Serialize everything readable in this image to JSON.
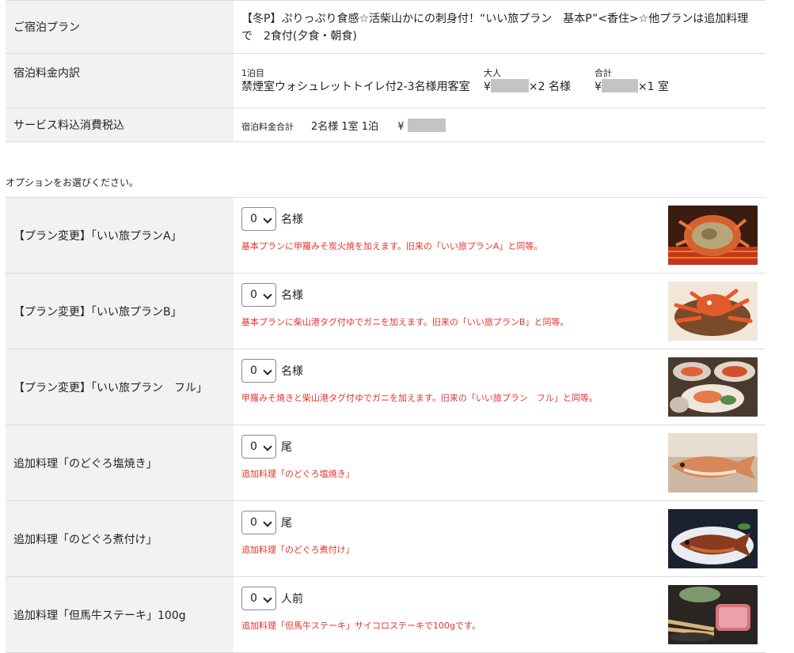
{
  "summary": {
    "plan_label": "ご宿泊プラン",
    "plan_name": "【冬P】ぷりっぷり食感☆活柴山かにの刺身付！“いい旅プラン　基本P”<香住>☆他プランは追加料理で　2食付(夕食・朝食)",
    "breakdown_label": "宿泊料金内訳",
    "night_head": "1泊目",
    "room_type": "禁煙室ウォシュレットトイレ付2-3名様用客室",
    "adult_head": "大人",
    "adult_value_prefix": "¥",
    "adult_value_suffix": "×2 名様",
    "total_head": "合計",
    "total_value_prefix": "¥",
    "total_value_suffix": "×1 室",
    "tax_label": "サービス料込消費税込",
    "grand_total_head": "宿泊料金合計",
    "grand_total_detail": "2名様  1室  1泊",
    "grand_total_prefix": "¥"
  },
  "options_title": "オプションをお選びください。",
  "options": [
    {
      "label": "【プラン変更】「いい旅プランA」",
      "selected": "0",
      "unit": "名様",
      "desc": "基本プランに甲羅みそ炭火焼を加えます。旧来の「いい旅プランA」と同等。",
      "image": "crab-grill-photo"
    },
    {
      "label": "【プラン変更】「いい旅プランB」",
      "selected": "0",
      "unit": "名様",
      "desc": "基本プランに柴山港タグ付ゆでガニを加えます。旧来の「いい旅プランB」と同等。",
      "image": "boiled-crab-photo"
    },
    {
      "label": "【プラン変更】「いい旅プラン　フル」",
      "selected": "0",
      "unit": "名様",
      "desc": "甲羅みそ焼きと柴山港タグ付ゆでガニを加えます。旧来の「いい旅プラン　フル」と同等。",
      "image": "crab-feast-photo"
    },
    {
      "label": "追加料理「のどぐろ塩焼き」",
      "selected": "0",
      "unit": "尾",
      "desc": "追加料理「のどぐろ塩焼き」",
      "image": "grilled-fish-photo"
    },
    {
      "label": "追加料理「のどぐろ煮付け」",
      "selected": "0",
      "unit": "尾",
      "desc": "追加料理「のどぐろ煮付け」",
      "image": "simmered-fish-photo"
    },
    {
      "label": "追加料理「但馬牛ステーキ」100g",
      "selected": "0",
      "unit": "人前",
      "desc": "追加料理「但馬牛ステーキ」サイコロステーキで100gです。",
      "image": "beef-steak-photo"
    }
  ]
}
